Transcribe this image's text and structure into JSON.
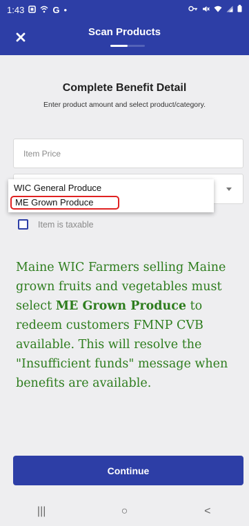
{
  "status_bar": {
    "time": "1:43",
    "left_icons": [
      "message-icon",
      "wifi-calling-icon",
      "google-icon",
      "dot-icon"
    ],
    "right_icons": [
      "key-icon",
      "mute-icon",
      "wifi-icon",
      "signal-icon",
      "battery-icon"
    ]
  },
  "app_bar": {
    "title": "Scan Products",
    "close_icon": "close-icon",
    "progress_fraction": 0.5
  },
  "form": {
    "heading": "Complete Benefit Detail",
    "subheading": "Enter product amount and select product/category.",
    "price_placeholder": "Item Price",
    "dropdown_options": [
      "WIC General Produce",
      "ME Grown Produce"
    ],
    "taxable_label": "Item is taxable",
    "taxable_checked": false
  },
  "note": {
    "part1": "Maine WIC Farmers selling Maine grown fruits and vegetables must select ",
    "bold": "ME Grown Produce",
    "part2": " to redeem customers FMNP CVB available. This will resolve the \"Insufficient funds\" message when benefits are available."
  },
  "continue_label": "Continue",
  "nav": {
    "recents_glyph": "|||",
    "home_glyph": "○",
    "back_glyph": "<"
  },
  "colors": {
    "primary": "#2d3ea6",
    "note_text": "#2e7d1e",
    "highlight": "#e02020",
    "background": "#eeeef0"
  }
}
